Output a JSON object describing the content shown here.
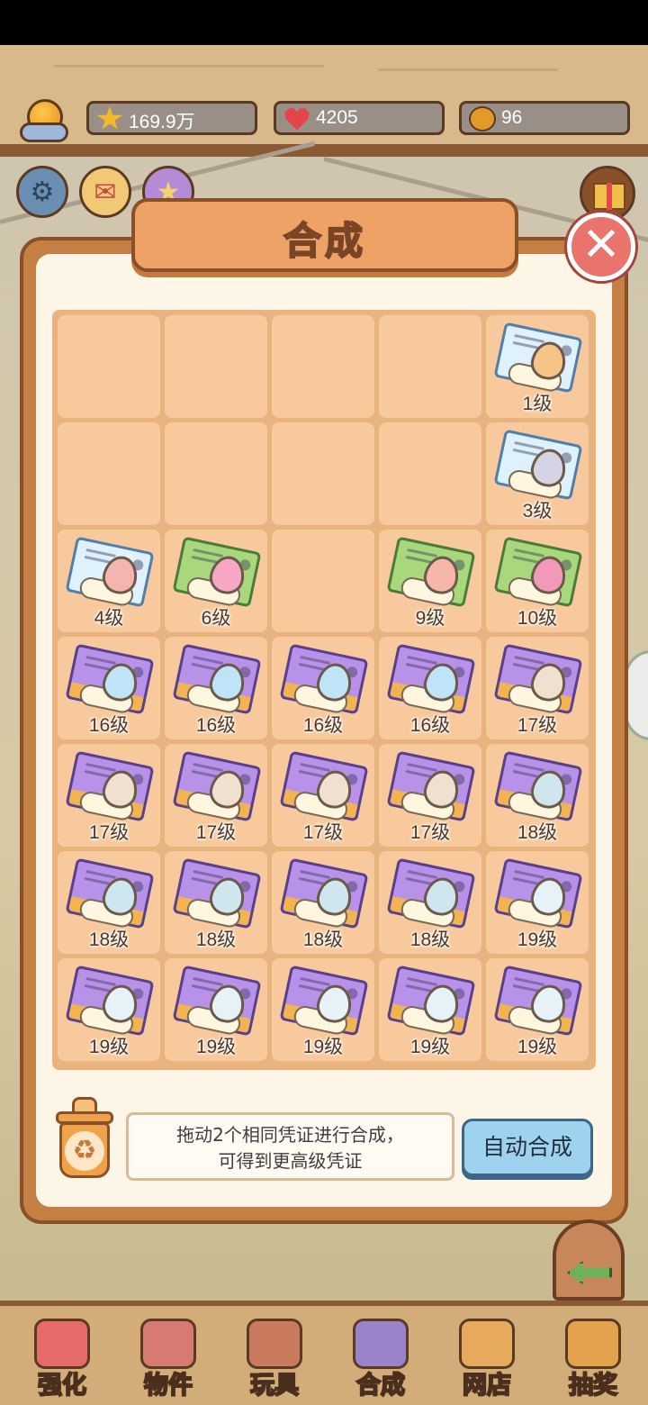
{
  "resources": {
    "stars": "169.9万",
    "hearts": "4205",
    "paws": "96"
  },
  "dialog": {
    "title": "合成",
    "close_icon": "close-icon"
  },
  "grid": {
    "rows": [
      [
        null,
        null,
        null,
        null,
        {
          "level": "1级",
          "card": "blue",
          "egg": "#f7c488"
        }
      ],
      [
        null,
        null,
        null,
        null,
        {
          "level": "3级",
          "card": "blue",
          "egg": "#d6d4e4"
        }
      ],
      [
        {
          "level": "4级",
          "card": "blue",
          "egg": "#f4b4b0"
        },
        {
          "level": "6级",
          "card": "green",
          "egg": "#f6a7c4"
        },
        null,
        {
          "level": "9级",
          "card": "green",
          "egg": "#f6b7a8"
        },
        {
          "level": "10级",
          "card": "green",
          "egg": "#f09ab8"
        }
      ],
      [
        {
          "level": "16级",
          "card": "purple",
          "egg": "#bfe3f7"
        },
        {
          "level": "16级",
          "card": "purple",
          "egg": "#bfe3f7"
        },
        {
          "level": "16级",
          "card": "purple",
          "egg": "#bfe3f7"
        },
        {
          "level": "16级",
          "card": "purple",
          "egg": "#bfe3f7"
        },
        {
          "level": "17级",
          "card": "purple",
          "egg": "#efe0cf"
        }
      ],
      [
        {
          "level": "17级",
          "card": "purple",
          "egg": "#efe0cf"
        },
        {
          "level": "17级",
          "card": "purple",
          "egg": "#efe0cf"
        },
        {
          "level": "17级",
          "card": "purple",
          "egg": "#efe0cf"
        },
        {
          "level": "17级",
          "card": "purple",
          "egg": "#efe0cf"
        },
        {
          "level": "18级",
          "card": "purple",
          "egg": "#cfe6ee"
        }
      ],
      [
        {
          "level": "18级",
          "card": "purple",
          "egg": "#cfe6ee"
        },
        {
          "level": "18级",
          "card": "purple",
          "egg": "#cfe6ee"
        },
        {
          "level": "18级",
          "card": "purple",
          "egg": "#cfe6ee"
        },
        {
          "level": "18级",
          "card": "purple",
          "egg": "#cfe6ee"
        },
        {
          "level": "19级",
          "card": "purple",
          "egg": "#e6f1f8"
        }
      ],
      [
        {
          "level": "19级",
          "card": "purple",
          "egg": "#e6f1f8"
        },
        {
          "level": "19级",
          "card": "purple",
          "egg": "#e6f1f8"
        },
        {
          "level": "19级",
          "card": "purple",
          "egg": "#e6f1f8"
        },
        {
          "level": "19级",
          "card": "purple",
          "egg": "#e6f1f8"
        },
        {
          "level": "19级",
          "card": "purple",
          "egg": "#e6f1f8"
        }
      ]
    ]
  },
  "hint": {
    "line1": "拖动2个相同凭证进行合成，",
    "line2": "可得到更高级凭证"
  },
  "auto_button": "自动合成",
  "tabs": [
    {
      "label": "强化",
      "color": "#e66a6a"
    },
    {
      "label": "物件",
      "color": "#d77a72"
    },
    {
      "label": "玩具",
      "color": "#c9795c"
    },
    {
      "label": "合成",
      "color": "#9b83c9"
    },
    {
      "label": "网店",
      "color": "#e7a95b"
    },
    {
      "label": "抽奖",
      "color": "#e4a24c"
    }
  ],
  "colors": {
    "panel": "#c47f45",
    "cell": "#f7c99c",
    "title_plate": "#eea266",
    "close": "#e9746b",
    "auto_button": "#9fd2ee"
  }
}
